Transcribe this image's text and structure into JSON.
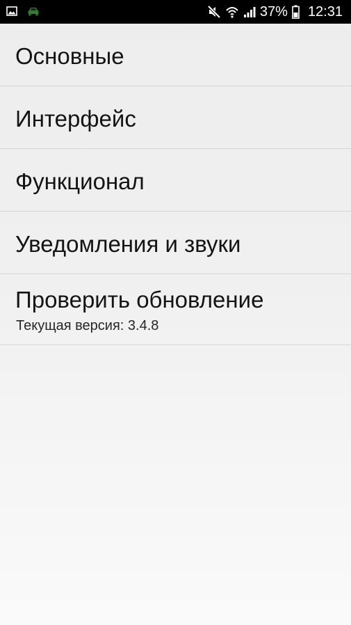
{
  "status_bar": {
    "icons_left": [
      "gallery-icon",
      "car-icon"
    ],
    "icons_right": [
      "mute-icon",
      "wifi-icon",
      "signal-icon",
      "battery-icon"
    ],
    "battery": "37%",
    "time": "12:31",
    "accent_colors": {
      "car_icon": "#2e7d32",
      "background": "#000000"
    }
  },
  "settings": {
    "items": [
      {
        "title": "Основные"
      },
      {
        "title": "Интерфейс"
      },
      {
        "title": "Функционал"
      },
      {
        "title": "Уведомления и звуки"
      },
      {
        "title": "Проверить обновление",
        "subtitle": "Текущая версия: 3.4.8"
      }
    ]
  }
}
